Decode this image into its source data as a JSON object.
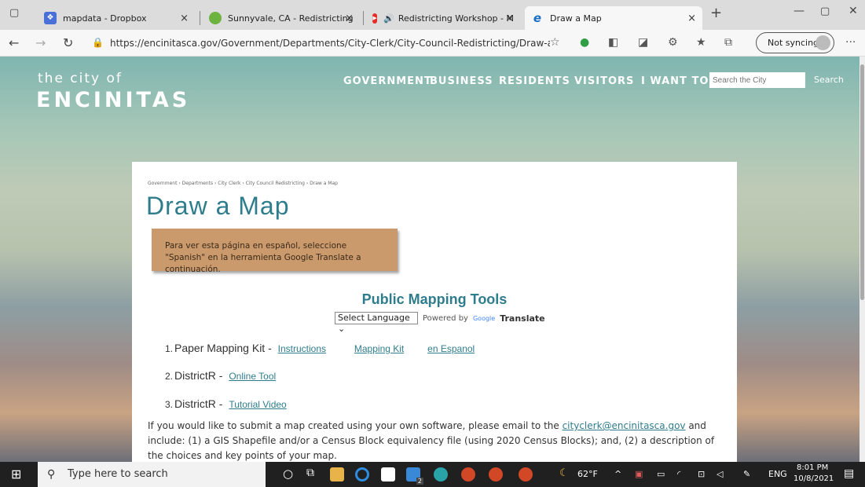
{
  "browser": {
    "tabs": [
      {
        "label": "mapdata - Dropbox",
        "icon": "dropbox-icon"
      },
      {
        "label": "Sunnyvale, CA - Redistricting",
        "icon": "sunnyvale-icon"
      },
      {
        "label": "Redistricting Workshop - M",
        "icon": "youtube-icon"
      },
      {
        "label": "Draw a Map",
        "icon": "edge-icon"
      }
    ],
    "url": "https://encinitasca.gov/Government/Departments/City-Clerk/City-Council-Redistricting/Draw-a...",
    "sync_label": "Not syncing",
    "add_tab": "+",
    "close_tab": "×",
    "menu": "···"
  },
  "site": {
    "logo_line1": "the city of",
    "logo_line2": "ENCINITAS",
    "nav": [
      "GOVERNMENT",
      "BUSINESS",
      "RESIDENTS",
      "VISITORS",
      "I WANT TO"
    ],
    "search_placeholder": "Search the City",
    "search_button": "Search"
  },
  "content": {
    "breadcrumb": "Government › Departments › City Clerk › City Council Redistricting › Draw a Map",
    "title": "Draw a Map",
    "notice": "Para ver esta página en español, seleccione \"Spanish\" en la herramienta Google Translate a continuación.",
    "section_title": "Public Mapping Tools",
    "language_select": "Select Language",
    "powered_by": "Powered by",
    "google": "Google",
    "translate": "Translate",
    "items": [
      {
        "num": "1.",
        "label": "Paper Mapping Kit - ",
        "links": [
          "Instructions",
          "Mapping Kit",
          "en Espanol"
        ]
      },
      {
        "num": "2.",
        "label": "DistrictR - ",
        "links": [
          "Online Tool"
        ]
      },
      {
        "num": "3.",
        "label": "DistrictR - ",
        "links": [
          "Tutorial Video"
        ]
      }
    ],
    "para_pre": "If you would like to submit a map created using your own software, please email to the ",
    "para_email": "cityclerk@encinitasca.gov",
    "para_post": " and include: (1) a GIS Shapefile and/or a Census Block equivalency file (using 2020 Census Blocks); and, (2) a description of the choices and key points of your  map."
  },
  "taskbar": {
    "search_placeholder": "Type here to search",
    "weather": "62°F",
    "lang": "ENG",
    "time": "8:01 PM",
    "date": "10/8/2021",
    "badge_count": "2"
  }
}
